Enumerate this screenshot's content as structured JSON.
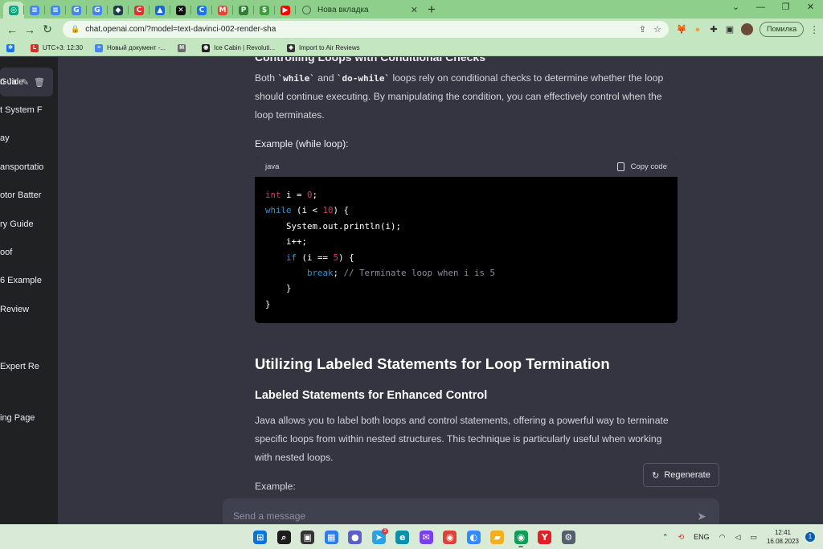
{
  "browser": {
    "tabs": [
      {
        "icon": "chatgpt-icon",
        "color": "#10a37f",
        "glyph": "◎",
        "active": true
      },
      {
        "icon": "docs-icon",
        "color": "#4285f4",
        "glyph": "≡"
      },
      {
        "icon": "docs-icon",
        "color": "#4285f4",
        "glyph": "≡"
      },
      {
        "icon": "translate-icon",
        "color": "#4285f4",
        "glyph": "G"
      },
      {
        "icon": "translate-icon",
        "color": "#4285f4",
        "glyph": "G"
      },
      {
        "icon": "shield-icon",
        "color": "#1f3b4d",
        "glyph": "◆"
      },
      {
        "icon": "c-circle-icon",
        "color": "#e0302f",
        "glyph": "C"
      },
      {
        "icon": "drive-icon",
        "color": "#1967d2",
        "glyph": "▲"
      },
      {
        "icon": "capcut-icon",
        "color": "#111111",
        "glyph": "✕"
      },
      {
        "icon": "c-blue-icon",
        "color": "#1a73e8",
        "glyph": "C"
      },
      {
        "icon": "gmail-icon",
        "color": "#ea4335",
        "glyph": "M"
      },
      {
        "icon": "p-icon",
        "color": "#2e7d32",
        "glyph": "P"
      },
      {
        "icon": "dollar-icon",
        "color": "#3c9d3c",
        "glyph": "$"
      },
      {
        "icon": "youtube-icon",
        "color": "#ff0000",
        "glyph": "▶"
      }
    ],
    "newtab_label": "Новa вкладка",
    "url": "chat.openai.com/?model=text-davinci-002-render-sha",
    "error_label": "Помилка",
    "bookmarks": [
      {
        "label": "",
        "icon": "bookmark-gear-icon",
        "color": "#1a73e8",
        "glyph": "✲"
      },
      {
        "label": "UTC+3: 12:30",
        "icon": "time-icon",
        "color": "#d32f2f",
        "glyph": "L"
      },
      {
        "label": "Новый документ -...",
        "icon": "document-icon",
        "color": "#4285f4",
        "glyph": "≡"
      },
      {
        "label": "",
        "icon": "m-icon",
        "color": "#6b6b6b",
        "glyph": "M"
      },
      {
        "label": "Ice Cabin | Revoluti...",
        "icon": "ice-cabin-icon",
        "color": "#222222",
        "glyph": "◉"
      },
      {
        "label": "Import to Air Reviews",
        "icon": "import-icon",
        "color": "#333333",
        "glyph": "◈"
      }
    ]
  },
  "sidebar": {
    "active_chat": "n Ja",
    "items": [
      "Guide",
      "t System F",
      "ay",
      "ansportatio",
      "otor Batter",
      "ry Guide",
      "oof",
      "6 Example",
      "Review",
      "Expert Re",
      "ing Page"
    ]
  },
  "content": {
    "cut_heading": "Controlling Loops with Conditional Checks",
    "para1_a": "Both ",
    "para1_code1": "`while`",
    "para1_b": " and ",
    "para1_code2": "`do-while`",
    "para1_c": " loops rely on conditional checks to determine whether the loop should continue executing. By manipulating the condition, you can effectively control when the loop terminates.",
    "example_label": "Example (while loop):",
    "code_lang": "java",
    "copy_label": "Copy code",
    "h2": "Utilizing Labeled Statements for Loop Termination",
    "h3": "Labeled Statements for Enhanced Control",
    "para2": "Java allows you to label both loops and control statements, offering a powerful way to terminate specific loops from within nested structures. This technique is particularly useful when working with nested loops.",
    "example2_label": "Example:",
    "regenerate_label": "Regenerate",
    "composer_placeholder": "Send a message"
  },
  "code": {
    "l1_type": "int",
    "l1_rest": " i = ",
    "l1_num": "0",
    "l1_end": ";",
    "l2_kw": "while",
    "l2_a": " (i < ",
    "l2_num": "10",
    "l2_b": ") {",
    "l3": "    System.out.println(i);",
    "l4": "    i++;",
    "l5_indent": "    ",
    "l5_kw": "if",
    "l5_a": " (i == ",
    "l5_num": "5",
    "l5_b": ") {",
    "l6_indent": "        ",
    "l6_kw": "break",
    "l6_a": "; ",
    "l6_cm": "// Terminate loop when i is 5",
    "l7": "    }",
    "l8": "}"
  },
  "taskbar": {
    "apps": [
      {
        "icon": "windows-start-icon",
        "color": "#0a74da",
        "glyph": "⊞"
      },
      {
        "icon": "search-icon",
        "color": "#1c1c1c",
        "glyph": "⌕"
      },
      {
        "icon": "task-view-icon",
        "color": "#333333",
        "glyph": "▣"
      },
      {
        "icon": "widgets-icon",
        "color": "#2b7de9",
        "glyph": "▦"
      },
      {
        "icon": "teams-icon",
        "color": "#5b5fc7",
        "glyph": "●"
      },
      {
        "icon": "telegram-icon",
        "color": "#2aa3e0",
        "glyph": "➤",
        "badge": "3"
      },
      {
        "icon": "edge-icon",
        "color": "#0c8fa8",
        "glyph": "e"
      },
      {
        "icon": "messenger-icon",
        "color": "#7a3ef0",
        "glyph": "✉"
      },
      {
        "icon": "chrome-icon",
        "color": "#db4437",
        "glyph": "◉"
      },
      {
        "icon": "zoom-icon",
        "color": "#2d8cff",
        "glyph": "◐"
      },
      {
        "icon": "file-explorer-icon",
        "color": "#f2b01e",
        "glyph": "▰"
      },
      {
        "icon": "chrome-icon",
        "color": "#0f9d58",
        "glyph": "◉",
        "running": true
      },
      {
        "icon": "yandex-browser-icon",
        "color": "#e31e24",
        "glyph": "Y"
      },
      {
        "icon": "settings-icon",
        "color": "#555f6d",
        "glyph": "⚙"
      }
    ],
    "tray_lang": "ENG",
    "time": "12:41",
    "date": "16.08.2023",
    "notifications": "1"
  }
}
